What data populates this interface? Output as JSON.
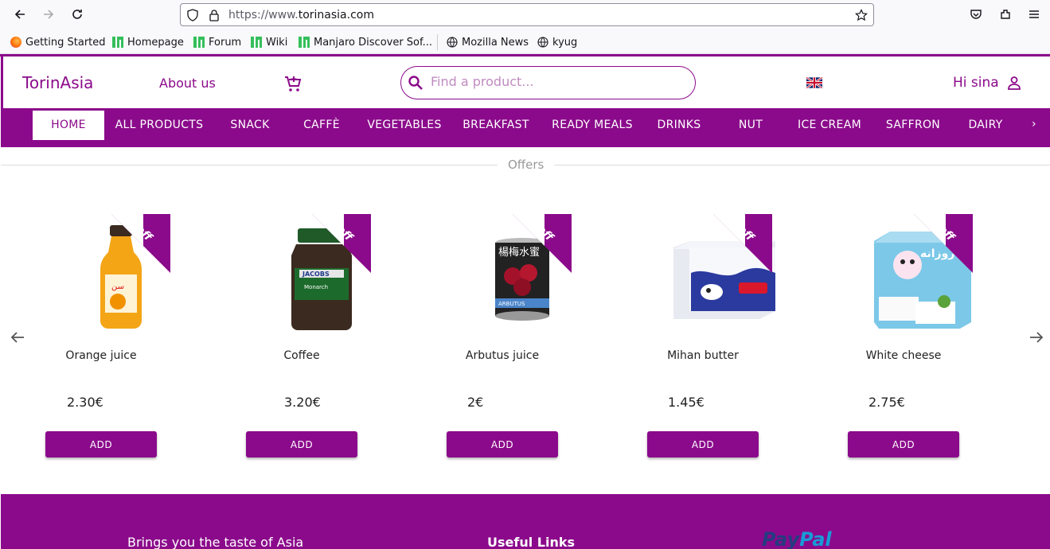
{
  "browser": {
    "url_prefix": "https://www.",
    "url_domain": "torinasia.com",
    "bookmarks": [
      {
        "label": "Getting Started",
        "icon": "firefox-icon"
      },
      {
        "label": "Homepage",
        "icon": "manjaro-icon"
      },
      {
        "label": "Forum",
        "icon": "manjaro-icon"
      },
      {
        "label": "Wiki",
        "icon": "manjaro-icon"
      },
      {
        "label": "Manjaro Discover Sof...",
        "icon": "manjaro-icon"
      },
      {
        "label": "Mozilla News",
        "icon": "globe-icon"
      },
      {
        "label": "kyug",
        "icon": "globe-icon"
      }
    ]
  },
  "header": {
    "brand": "TorinAsia",
    "about": "About us",
    "search_placeholder": "Find a product...",
    "greeting": "Hi sina"
  },
  "categories": [
    {
      "label": "HOME",
      "active": true
    },
    {
      "label": "ALL PRODUCTS"
    },
    {
      "label": "SNACK"
    },
    {
      "label": "CAFFÈ"
    },
    {
      "label": "VEGETABLES"
    },
    {
      "label": "BREAKFAST"
    },
    {
      "label": "READY MEALS"
    },
    {
      "label": "DRINKS"
    },
    {
      "label": "NUT"
    },
    {
      "label": "ICE CREAM"
    },
    {
      "label": "SAFFRON"
    },
    {
      "label": "DAIRY"
    }
  ],
  "offers": {
    "title": "Offers",
    "ribbon": "off",
    "add_label": "ADD",
    "products": [
      {
        "name": "Orange juice",
        "price": "2.30€"
      },
      {
        "name": "Coffee",
        "price": "3.20€"
      },
      {
        "name": "Arbutus juice",
        "price": "2€"
      },
      {
        "name": "Mihan butter",
        "price": "1.45€"
      },
      {
        "name": "White cheese",
        "price": "2.75€"
      }
    ]
  },
  "footer": {
    "tagline": "Brings you the taste of Asia",
    "links_title": "Useful Links",
    "paypal_a": "Pay",
    "paypal_b": "Pal"
  },
  "colors": {
    "brand": "#8b0a8b"
  }
}
